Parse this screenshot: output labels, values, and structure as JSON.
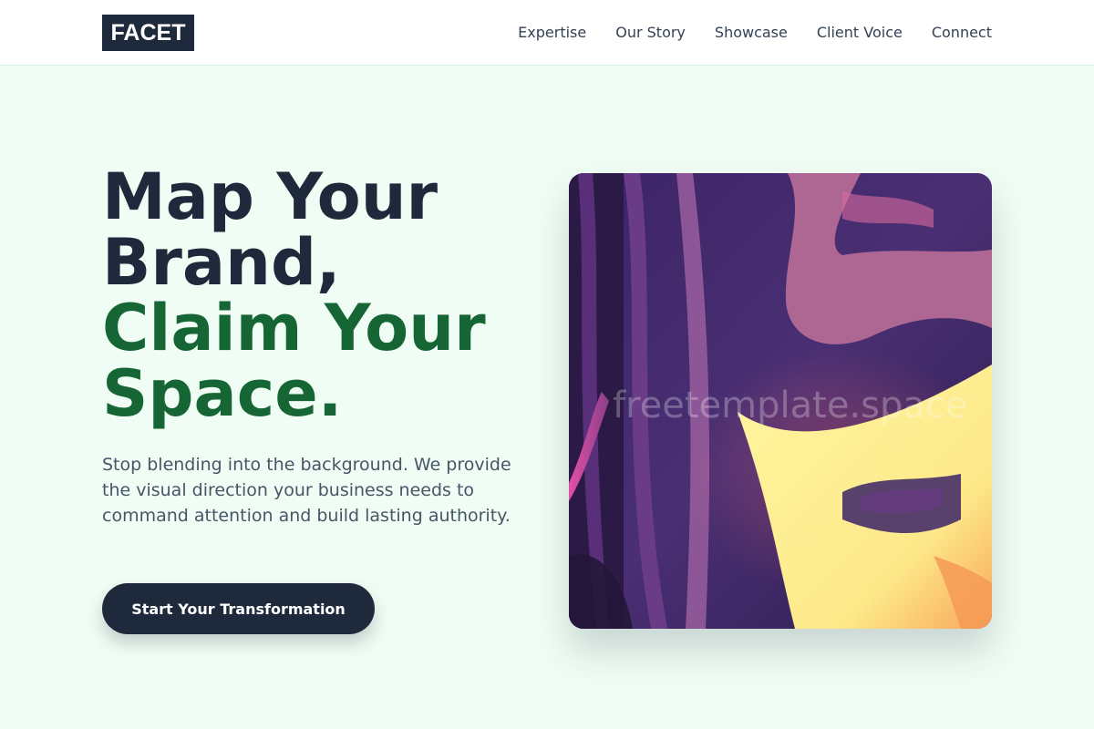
{
  "header": {
    "logo_text": "FACET",
    "nav": [
      "Expertise",
      "Our Story",
      "Showcase",
      "Client Voice",
      "Connect"
    ]
  },
  "hero": {
    "title_line1": "Map Your",
    "title_line2": "Brand,",
    "title_line3": "Claim Your",
    "title_line4": "Space.",
    "description": "Stop blending into the background. We provide the visual direction your business needs to command attention and build lasting authority.",
    "cta_label": "Start Your Transformation",
    "image_watermark": "freetemplate.space"
  },
  "colors": {
    "background": "#f0fdf4",
    "dark": "#1e293b",
    "accent_green": "#166534",
    "body_text": "#475569"
  },
  "icons": {
    "hero_image": "abstract-purple-yellow-artwork"
  }
}
